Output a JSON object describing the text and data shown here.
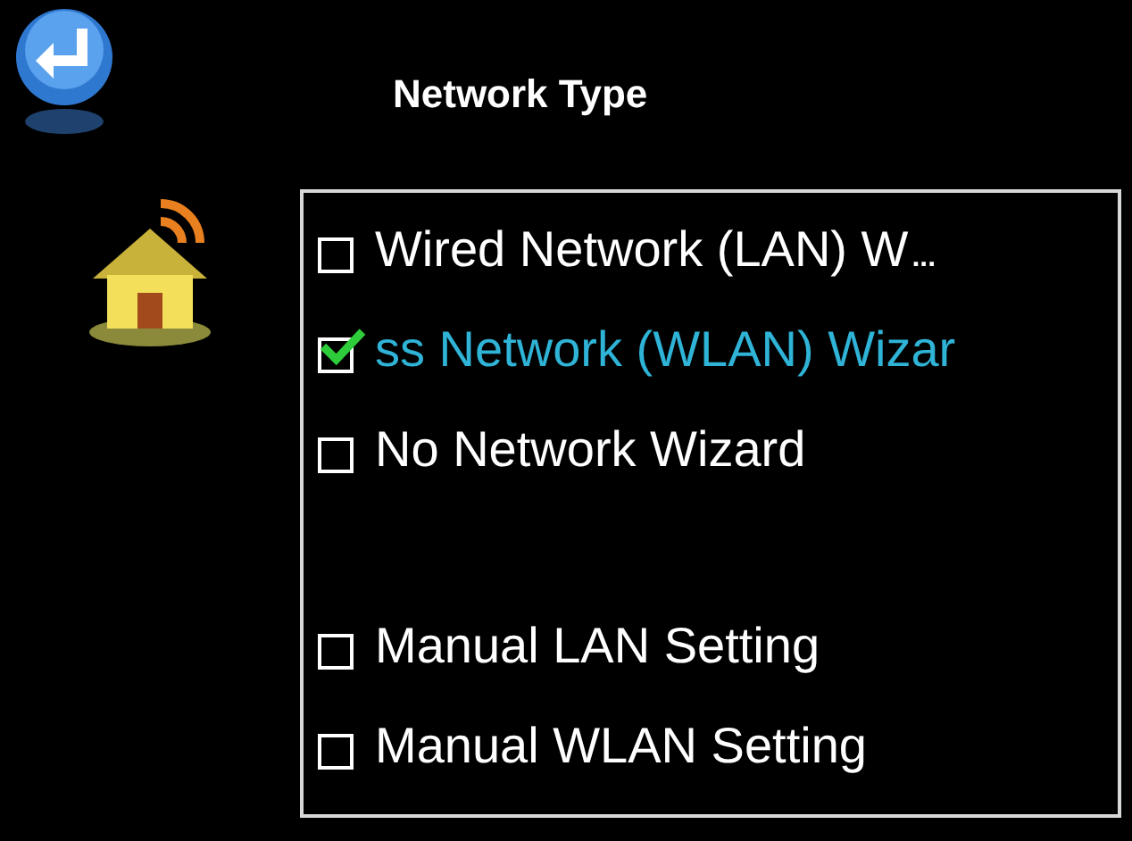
{
  "title": "Network Type",
  "wizards": [
    {
      "label": "Wired Network (LAN) W",
      "more": "...",
      "checked": false,
      "selected": false
    },
    {
      "label": "ss Network (WLAN) Wizar",
      "checked": true,
      "selected": true
    },
    {
      "label": "No Network Wizard",
      "checked": false,
      "selected": false
    }
  ],
  "manual_settings": [
    {
      "label": "Manual LAN Setting",
      "checked": false,
      "selected": false
    },
    {
      "label": "Manual WLAN Setting",
      "checked": false,
      "selected": false
    }
  ]
}
